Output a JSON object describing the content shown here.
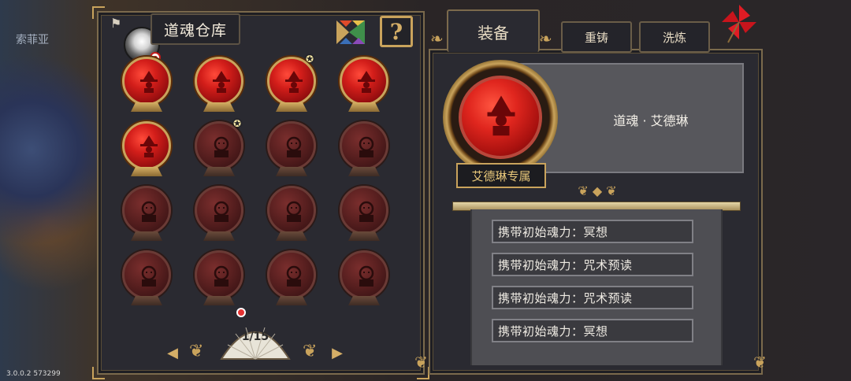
{
  "background": {
    "location_text": "索菲亚",
    "version": "3.0.0.2 573299"
  },
  "warehouse": {
    "title": "道魂仓库",
    "help_label": "?",
    "icons": [
      "tangram-icon",
      "help-icon",
      "avatar-icon"
    ],
    "orbs": [
      {
        "unlocked": true,
        "star": false
      },
      {
        "unlocked": true,
        "star": false
      },
      {
        "unlocked": true,
        "star": true
      },
      {
        "unlocked": true,
        "star": false
      },
      {
        "unlocked": true,
        "star": false
      },
      {
        "unlocked": false,
        "star": true
      },
      {
        "unlocked": false,
        "star": false
      },
      {
        "unlocked": false,
        "star": false
      },
      {
        "unlocked": false,
        "star": false
      },
      {
        "unlocked": false,
        "star": false
      },
      {
        "unlocked": false,
        "star": false
      },
      {
        "unlocked": false,
        "star": false
      },
      {
        "unlocked": false,
        "star": false
      },
      {
        "unlocked": false,
        "star": false
      },
      {
        "unlocked": false,
        "star": false
      },
      {
        "unlocked": false,
        "star": false
      }
    ],
    "page": "1/15",
    "prev_label": "◀",
    "next_label": "▶"
  },
  "tabs": {
    "equip": "装备",
    "reforge": "重铸",
    "refine": "洗炼"
  },
  "detail": {
    "name": "道魂 · 艾德琳",
    "exclusive": "艾德琳专属",
    "effects": [
      "携带初始魂力：冥想",
      "携带初始魂力：咒术预读",
      "携带初始魂力：咒术预读",
      "携带初始魂力：冥想"
    ]
  },
  "colors": {
    "panel_bg": "#2a2a31",
    "gold_trim": "#c9a35c",
    "orb_red": "#d31e1a",
    "orb_locked": "#5a2020"
  }
}
